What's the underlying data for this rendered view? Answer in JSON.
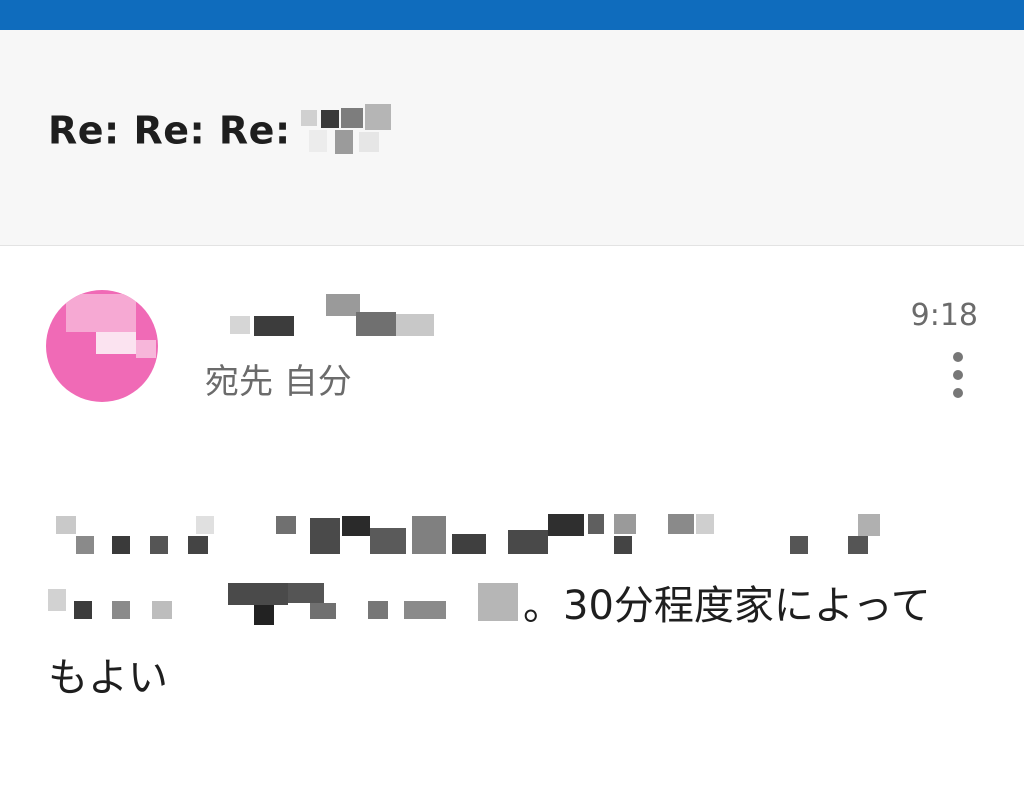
{
  "header": {
    "subject": "Re: Re: Re:"
  },
  "message": {
    "time": "9:18",
    "recipient": "宛先 自分",
    "body_line2_tail": "。30分程度家によって",
    "body_line3": "もよい"
  },
  "colors": {
    "status_bar": "#0f6cbd",
    "avatar": "#f06ab6"
  },
  "icons": {
    "more": "vertical-ellipsis-icon"
  }
}
